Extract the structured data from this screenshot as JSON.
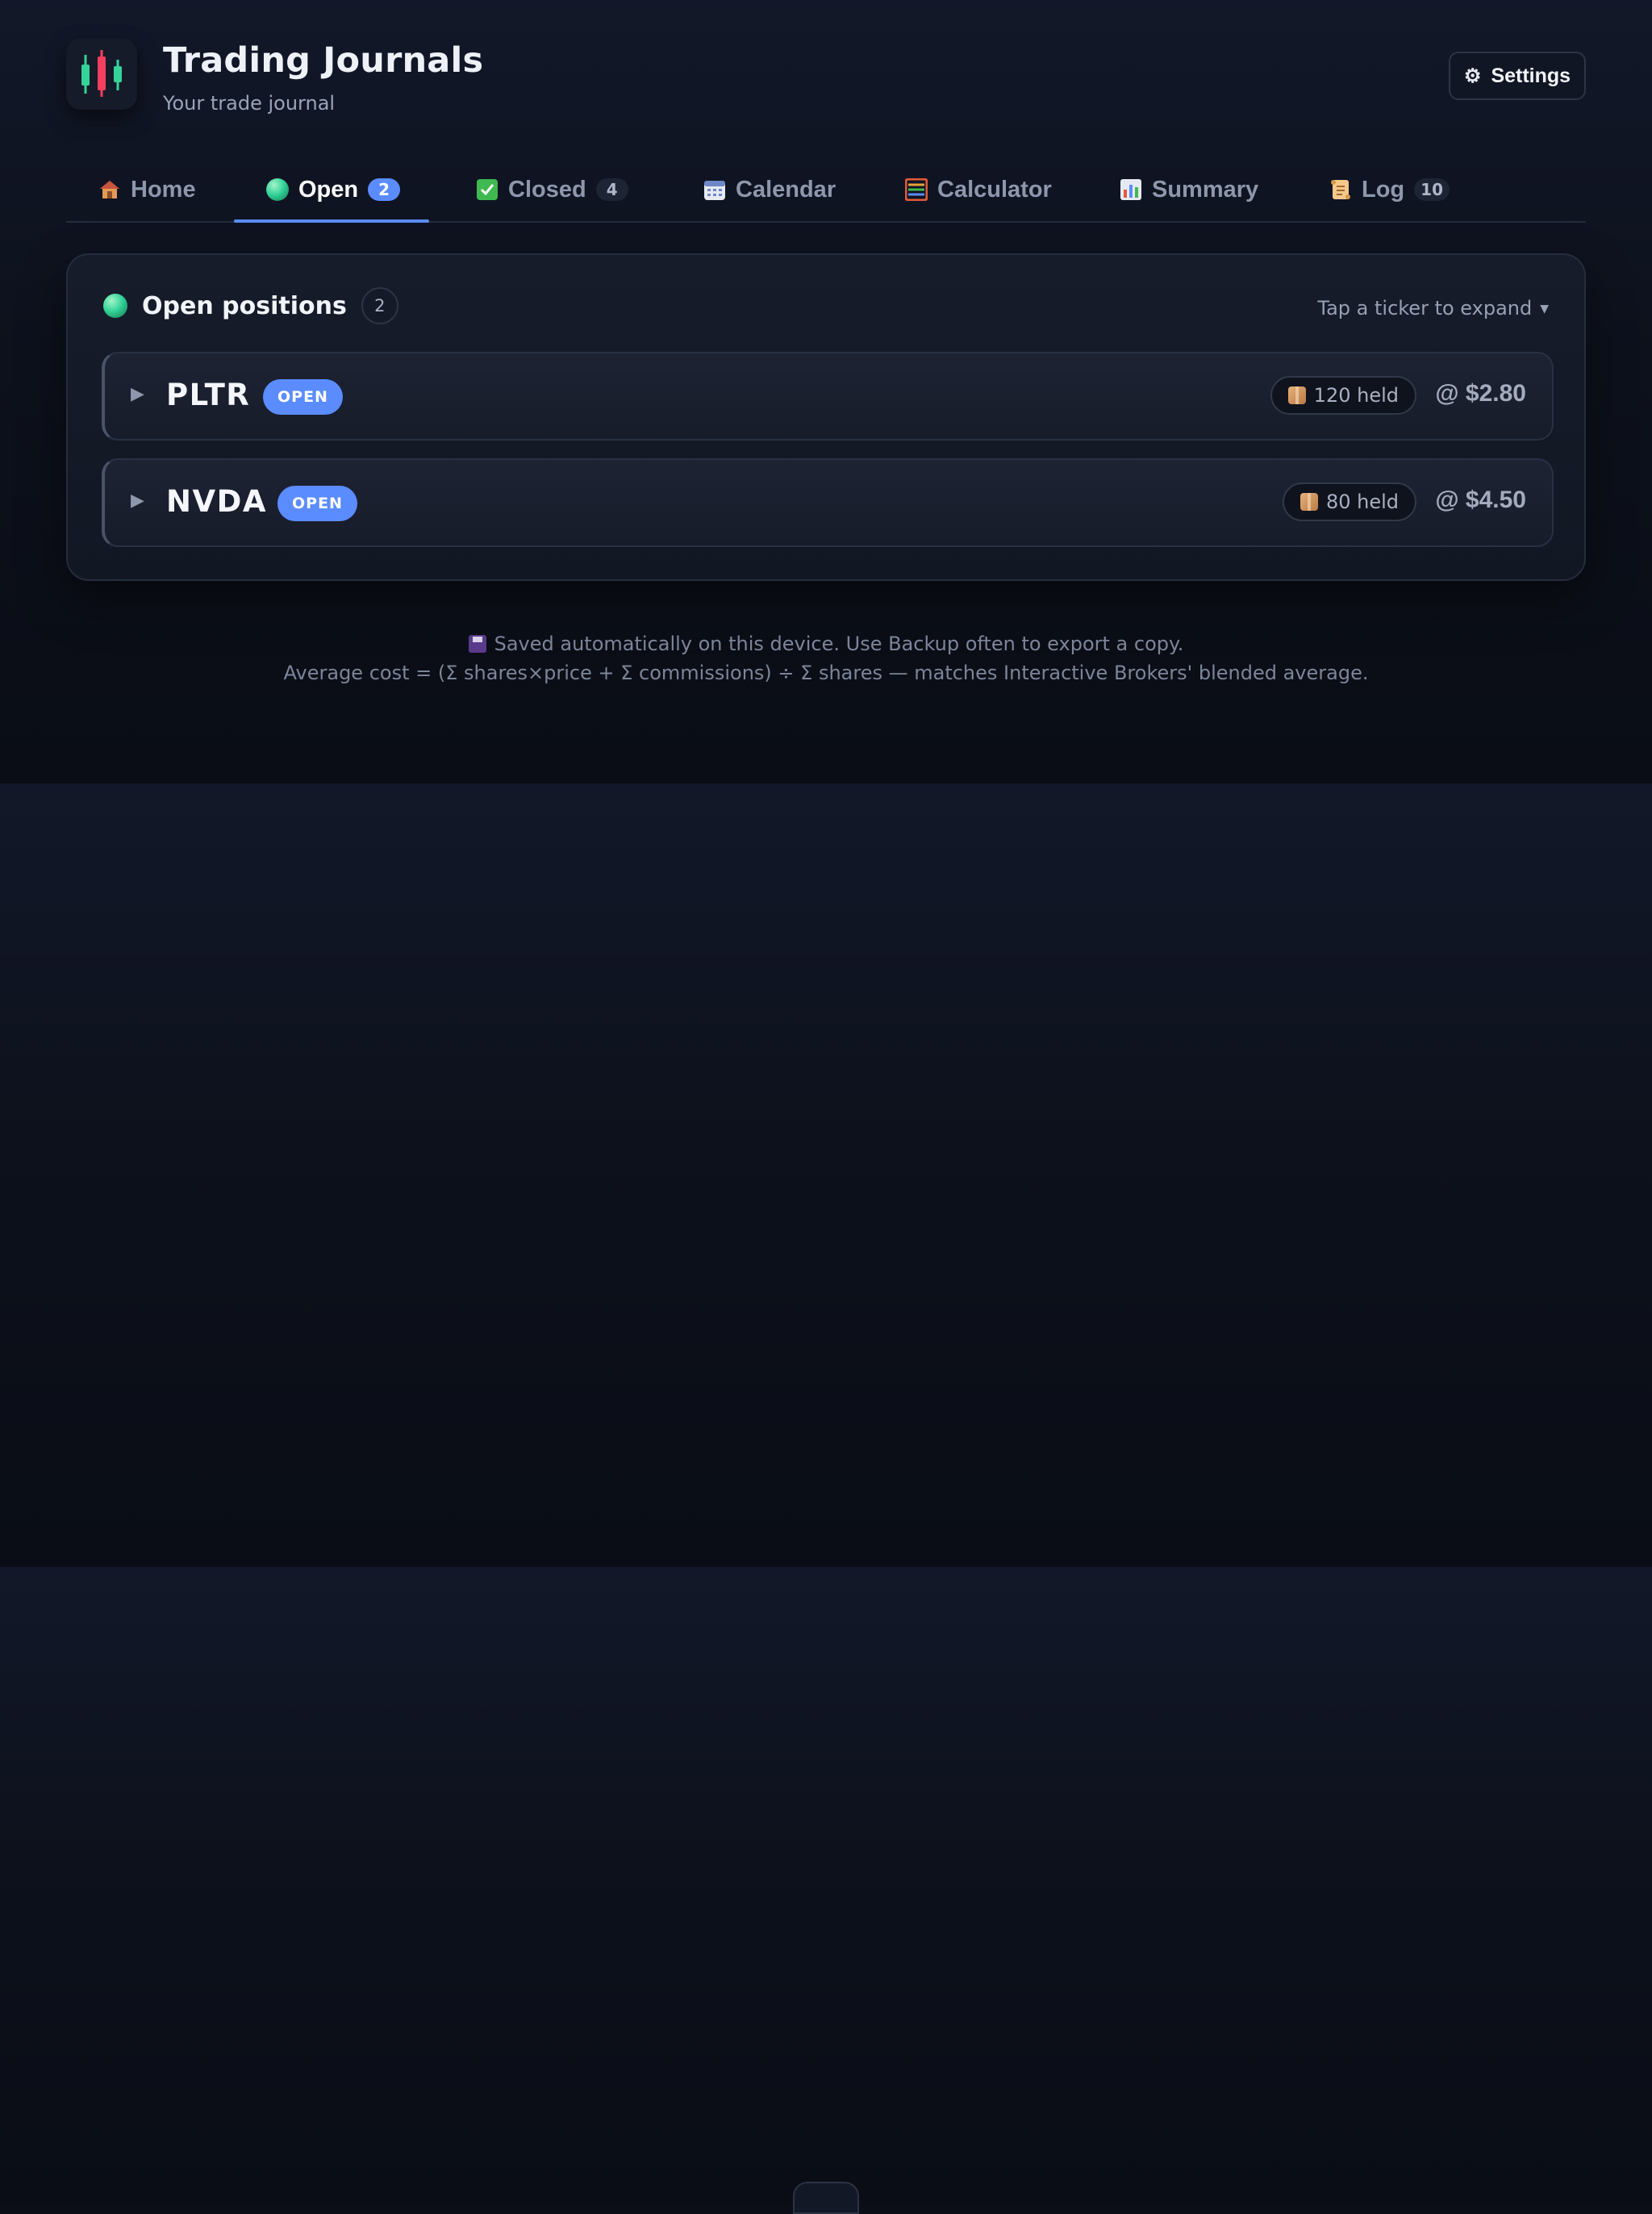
{
  "app": {
    "title": "Trading Journals",
    "subtitle": "Your trade journal",
    "settings_label": "Settings",
    "accent": "#5b8cff"
  },
  "tabs": [
    {
      "label": "Home",
      "icon": "house-icon",
      "count": null,
      "active": false
    },
    {
      "label": "Open",
      "icon": "green-circle-icon",
      "count": "2",
      "active": true
    },
    {
      "label": "Closed",
      "icon": "check-box-icon",
      "count": "4",
      "active": false
    },
    {
      "label": "Calendar",
      "icon": "calendar-icon",
      "count": null,
      "active": false
    },
    {
      "label": "Calculator",
      "icon": "abacus-icon",
      "count": null,
      "active": false
    },
    {
      "label": "Summary",
      "icon": "bar-chart-icon",
      "count": null,
      "active": false
    },
    {
      "label": "Log",
      "icon": "scroll-icon",
      "count": "10",
      "active": false
    }
  ],
  "panel": {
    "title": "Open positions",
    "count": "2",
    "hint": "Tap a ticker to expand"
  },
  "positions": [
    {
      "ticker": "PLTR",
      "status": "OPEN",
      "held": "120 held",
      "price": "@ $2.80"
    },
    {
      "ticker": "NVDA",
      "status": "OPEN",
      "held": "80 held",
      "price": "@ $4.50"
    }
  ],
  "notes": {
    "saved": "Saved automatically on this device. Use Backup often to export a copy.",
    "average": "Average cost = (Σ shares×price + Σ commissions) ÷ Σ shares — matches Interactive Brokers' blended average."
  }
}
